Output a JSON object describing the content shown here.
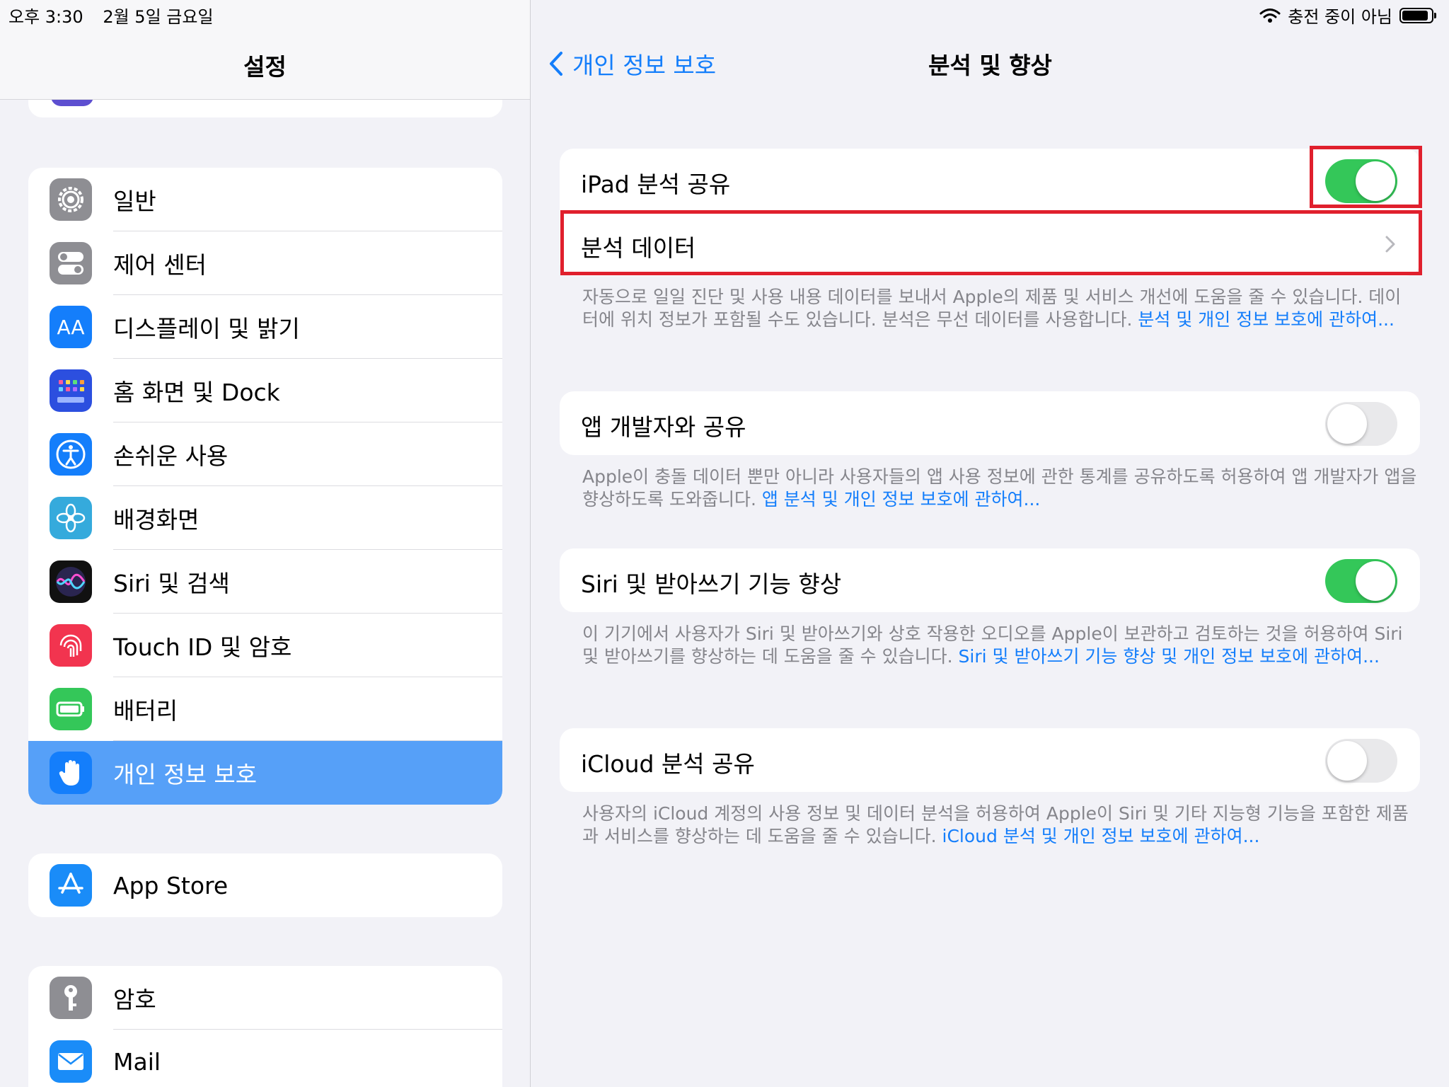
{
  "status_bar": {
    "time": "오후 3:30",
    "date": "2월 5일 금요일",
    "charging": "충전 중이 아님",
    "battery_level": 0.9
  },
  "sidebar": {
    "title": "설정",
    "group1": [
      {
        "label": "일반",
        "icon": "gear-icon",
        "color": "#8e8e93"
      },
      {
        "label": "제어 센터",
        "icon": "toggles-icon",
        "color": "#8e8e93"
      },
      {
        "label": "디스플레이 및 밝기",
        "icon": "text-size-icon",
        "color": "#147efb"
      },
      {
        "label": "홈 화면 및 Dock",
        "icon": "app-grid-icon",
        "color": "#2c4fdf"
      },
      {
        "label": "손쉬운 사용",
        "icon": "accessibility-icon",
        "color": "#147efb"
      },
      {
        "label": "배경화면",
        "icon": "flower-icon",
        "color": "#35aadc"
      },
      {
        "label": "Siri 및 검색",
        "icon": "siri-icon",
        "color": "#1a1a2e"
      },
      {
        "label": "Touch ID 및 암호",
        "icon": "fingerprint-icon",
        "color": "#f2344f"
      },
      {
        "label": "배터리",
        "icon": "battery-icon",
        "color": "#34c759"
      },
      {
        "label": "개인 정보 보호",
        "icon": "hand-icon",
        "color": "#147efb",
        "selected": true
      }
    ],
    "group2": [
      {
        "label": "App Store",
        "icon": "app-store-icon",
        "color": "#1a8cf8"
      }
    ],
    "group3": [
      {
        "label": "암호",
        "icon": "key-icon",
        "color": "#8e8e93"
      },
      {
        "label": "Mail",
        "icon": "envelope-icon",
        "color": "#1a8cf8"
      }
    ]
  },
  "detail": {
    "back_label": "개인 정보 보호",
    "title": "분석 및 향상",
    "sections": [
      {
        "rows": [
          {
            "label": "iPad 분석 공유",
            "toggle": true
          },
          {
            "label": "분석 데이터",
            "chevron": true
          }
        ],
        "footer": "자동으로 일일 진단 및 사용 내용 데이터를 보내서 Apple의 제품 및 서비스 개선에 도움을 줄 수 있습니다. 데이터에 위치 정보가 포함될 수도 있습니다. 분석은 무선 데이터를 사용합니다.",
        "footer_link": "분석 및 개인 정보 보호에 관하여..."
      },
      {
        "rows": [
          {
            "label": "앱 개발자와 공유",
            "toggle": false
          }
        ],
        "footer": "Apple이 충돌 데이터 뿐만 아니라 사용자들의 앱 사용 정보에 관한 통계를 공유하도록 허용하여 앱 개발자가 앱을 향상하도록 도와줍니다.",
        "footer_link": "앱 분석 및 개인 정보 보호에 관하여..."
      },
      {
        "rows": [
          {
            "label": "Siri 및 받아쓰기 기능 향상",
            "toggle": true
          }
        ],
        "footer": "이 기기에서 사용자가 Siri 및 받아쓰기와 상호 작용한 오디오를 Apple이 보관하고 검토하는 것을 허용하여 Siri 및 받아쓰기를 향상하는 데 도움을 줄 수 있습니다.",
        "footer_link": "Siri 및 받아쓰기 기능 향상 및 개인 정보 보호에 관하여..."
      },
      {
        "rows": [
          {
            "label": "iCloud 분석 공유",
            "toggle": false
          }
        ],
        "footer": "사용자의 iCloud 계정의 사용 정보 및 데이터 분석을 허용하여 Apple이 Siri 및 기타 지능형 기능을 포함한 제품과 서비스를 향상하는 데 도움을 줄 수 있습니다.",
        "footer_link": "iCloud 분석 및 개인 정보 보호에 관하여..."
      }
    ]
  },
  "highlight_color": "#e0202d"
}
